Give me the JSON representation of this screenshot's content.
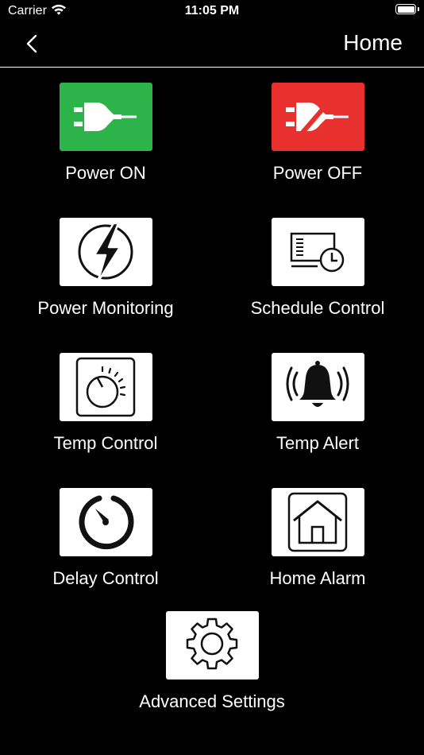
{
  "status_bar": {
    "carrier": "Carrier",
    "time": "11:05 PM"
  },
  "nav": {
    "title": "Home"
  },
  "tiles": [
    {
      "label": "Power ON",
      "icon": "power-plug-icon",
      "color": "#2cb34a"
    },
    {
      "label": "Power OFF",
      "icon": "power-plug-off-icon",
      "color": "#e8302f"
    },
    {
      "label": "Power Monitoring",
      "icon": "lightning-icon",
      "color": "#ffffff"
    },
    {
      "label": "Schedule Control",
      "icon": "schedule-clock-icon",
      "color": "#ffffff"
    },
    {
      "label": "Temp Control",
      "icon": "thermostat-dial-icon",
      "color": "#ffffff"
    },
    {
      "label": "Temp Alert",
      "icon": "alarm-bell-icon",
      "color": "#ffffff"
    },
    {
      "label": "Delay Control",
      "icon": "timer-icon",
      "color": "#ffffff"
    },
    {
      "label": "Home Alarm",
      "icon": "house-icon",
      "color": "#ffffff"
    },
    {
      "label": "Advanced Settings",
      "icon": "gear-icon",
      "color": "#ffffff"
    }
  ]
}
